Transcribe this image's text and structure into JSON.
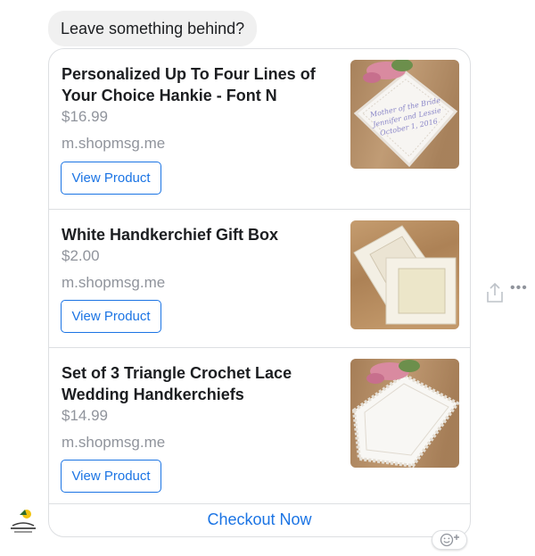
{
  "message": {
    "text": "Leave something behind?"
  },
  "products": [
    {
      "title": "Personalized Up To Four Lines of Your Choice Hankie - Font N",
      "price": "$16.99",
      "domain": "m.shopmsg.me",
      "button_label": "View Product"
    },
    {
      "title": "White Handkerchief Gift Box",
      "price": "$2.00",
      "domain": "m.shopmsg.me",
      "button_label": "View Product"
    },
    {
      "title": "Set of 3 Triangle Crochet Lace Wedding Handkerchiefs",
      "price": "$14.99",
      "domain": "m.shopmsg.me",
      "button_label": "View Product"
    }
  ],
  "checkout": {
    "label": "Checkout Now"
  },
  "colors": {
    "accent": "#1b74e4",
    "muted": "#90949c",
    "bubble": "#f0f0f0"
  },
  "icons": {
    "share": "share-icon",
    "more": "more-options-icon",
    "react": "add-reaction-icon"
  }
}
